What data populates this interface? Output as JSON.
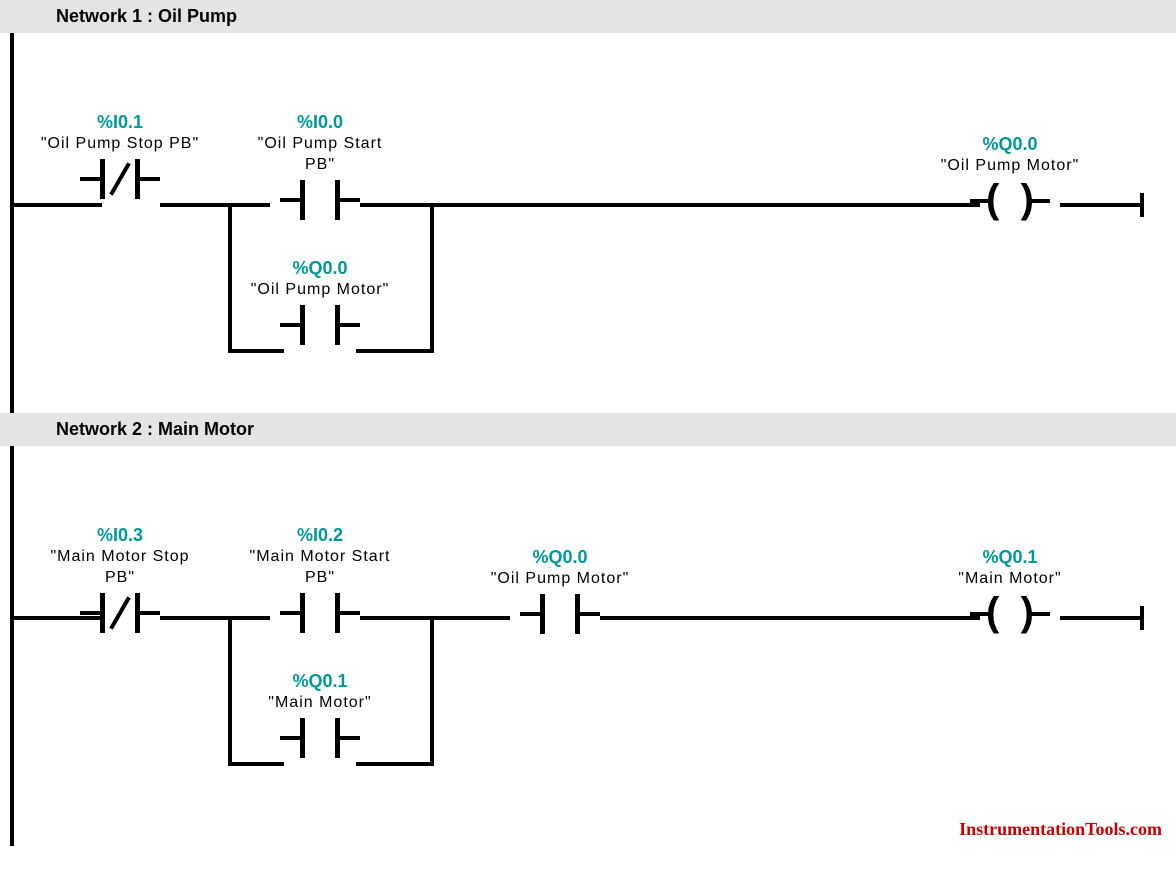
{
  "networks": [
    {
      "title": "Network 1 : Oil Pump",
      "elements": {
        "nc1": {
          "addr": "%I0.1",
          "label": "\"Oil Pump Stop PB\""
        },
        "no1": {
          "addr": "%I0.0",
          "label": "\"Oil Pump Start PB\""
        },
        "coil": {
          "addr": "%Q0.0",
          "label": "\"Oil Pump Motor\""
        },
        "seal": {
          "addr": "%Q0.0",
          "label": "\"Oil Pump Motor\""
        }
      }
    },
    {
      "title": "Network 2 : Main Motor",
      "elements": {
        "nc1": {
          "addr": "%I0.3",
          "label": "\"Main Motor Stop PB\""
        },
        "no1": {
          "addr": "%I0.2",
          "label": "\"Main Motor Start PB\""
        },
        "no2": {
          "addr": "%Q0.0",
          "label": "\"Oil Pump Motor\""
        },
        "coil": {
          "addr": "%Q0.1",
          "label": "\"Main Motor\""
        },
        "seal": {
          "addr": "%Q0.1",
          "label": "\"Main Motor\""
        }
      }
    }
  ],
  "watermark": "InstrumentationTools.com"
}
